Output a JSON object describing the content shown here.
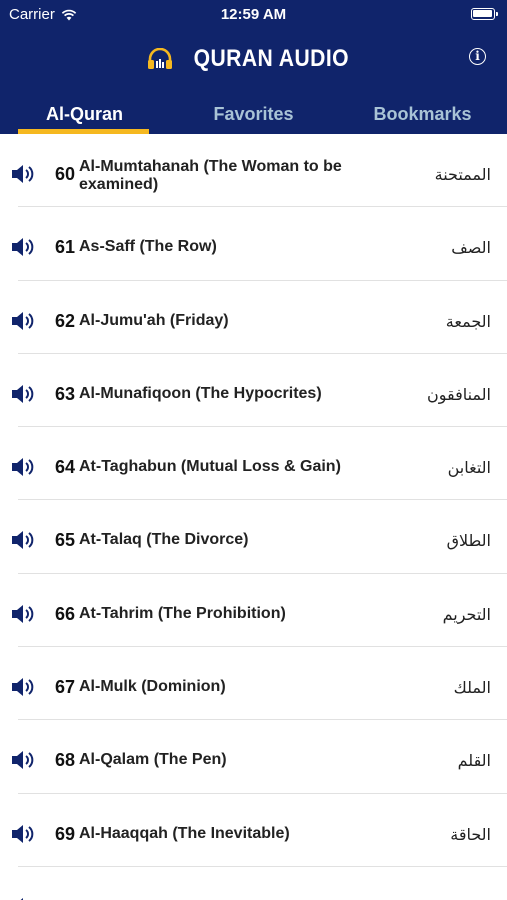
{
  "status_bar": {
    "carrier": "Carrier",
    "time": "12:59 AM"
  },
  "header": {
    "title": "QURAN AUDIO",
    "icons": {
      "logo": "headphones-icon",
      "info": "info-icon"
    }
  },
  "colors": {
    "header_bg": "#10246b",
    "tab_active": "#ffffff",
    "tab_inactive": "#a9c3d6",
    "accent": "#f5b820"
  },
  "tabs": [
    {
      "label": "Al-Quran",
      "active": true
    },
    {
      "label": "Favorites",
      "active": false
    },
    {
      "label": "Bookmarks",
      "active": false
    }
  ],
  "surahs": [
    {
      "number": "60",
      "name": "Al-Mumtahanah (The Woman to be examined)",
      "arabic": "الممتحنة"
    },
    {
      "number": "61",
      "name": "As-Saff (The Row)",
      "arabic": "الصف"
    },
    {
      "number": "62",
      "name": "Al-Jumu'ah (Friday)",
      "arabic": "الجمعة"
    },
    {
      "number": "63",
      "name": "Al-Munafiqoon (The Hypocrites)",
      "arabic": "المنافقون"
    },
    {
      "number": "64",
      "name": "At-Taghabun (Mutual Loss & Gain)",
      "arabic": "التغابن"
    },
    {
      "number": "65",
      "name": "At-Talaq (The Divorce)",
      "arabic": "الطلاق"
    },
    {
      "number": "66",
      "name": "At-Tahrim (The Prohibition)",
      "arabic": "التحريم"
    },
    {
      "number": "67",
      "name": "Al-Mulk (Dominion)",
      "arabic": "الملك"
    },
    {
      "number": "68",
      "name": "Al-Qalam (The Pen)",
      "arabic": "القلم"
    },
    {
      "number": "69",
      "name": "Al-Haaqqah (The Inevitable)",
      "arabic": "الحاقة"
    }
  ]
}
